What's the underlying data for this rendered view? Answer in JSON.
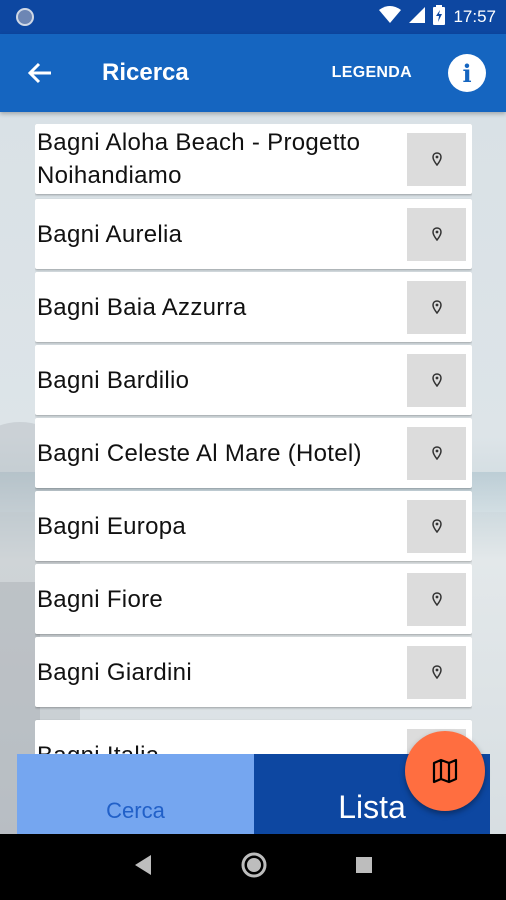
{
  "status_bar": {
    "time": "17:57"
  },
  "app_bar": {
    "title": "Ricerca",
    "legend_label": "LEGENDA",
    "info_label": "i"
  },
  "beaches": [
    {
      "name": "Bagni Aloha Beach - Progetto Noihandiamo"
    },
    {
      "name": "Bagni Aurelia"
    },
    {
      "name": "Bagni Baia Azzurra"
    },
    {
      "name": "Bagni Bardilio"
    },
    {
      "name": "Bagni Celeste Al Mare (Hotel)"
    },
    {
      "name": "Bagni Europa"
    },
    {
      "name": "Bagni Fiore"
    },
    {
      "name": "Bagni Giardini"
    },
    {
      "name": "Bagni Italia"
    }
  ],
  "tabs": {
    "cerca": "Cerca",
    "lista": "Lista"
  },
  "colors": {
    "primary": "#1565c0",
    "primary_dark": "#0d47a1",
    "accent": "#ff6e40",
    "tab_light": "#75a6f0"
  },
  "icons": [
    "back-arrow-icon",
    "info-icon",
    "map-pin-icon",
    "map-icon",
    "nav-back-icon",
    "nav-home-icon",
    "nav-recents-icon"
  ]
}
